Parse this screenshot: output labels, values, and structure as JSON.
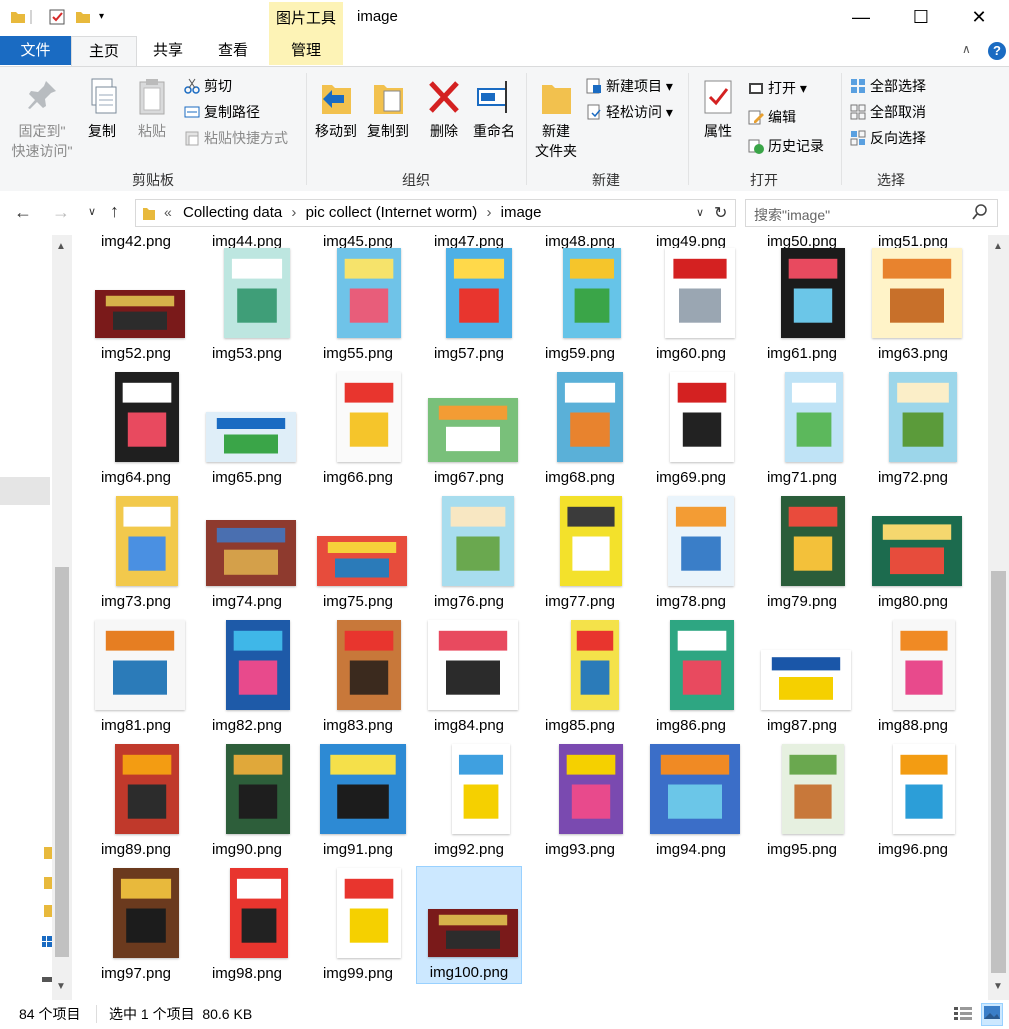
{
  "window": {
    "title": "image",
    "context_tab": "图片工具",
    "minimize_glyph": "—",
    "maximize_glyph": "☐",
    "close_glyph": "✕"
  },
  "ribbon_tabs": {
    "file": "文件",
    "home": "主页",
    "share": "共享",
    "view": "查看",
    "manage": "管理"
  },
  "clipboard": {
    "pin": "固定到\"",
    "pin2": "快速访问\"",
    "copy": "复制",
    "paste": "粘贴",
    "cut": "剪切",
    "copy_path": "复制路径",
    "paste_shortcut": "粘贴快捷方式",
    "label": "剪贴板"
  },
  "organize": {
    "move_to": "移动到",
    "copy_to": "复制到",
    "delete": "删除",
    "rename": "重命名",
    "label": "组织"
  },
  "new_group": {
    "new_folder": "新建",
    "new_folder2": "文件夹",
    "new_item": "新建项目",
    "easy_access": "轻松访问",
    "label": "新建"
  },
  "open_group": {
    "properties": "属性",
    "open": "打开",
    "edit": "编辑",
    "history": "历史记录",
    "label": "打开"
  },
  "select_group": {
    "select_all": "全部选择",
    "select_none": "全部取消",
    "invert": "反向选择",
    "label": "选择"
  },
  "address": {
    "crumbs": [
      "Collecting data",
      "pic collect (Internet worm)",
      "image"
    ],
    "search_placeholder": "搜索\"image\""
  },
  "partial_row": [
    "img42.png",
    "img44.png",
    "img45.png",
    "img47.png",
    "img48.png",
    "img49.png",
    "img50.png",
    "img51.png"
  ],
  "files": [
    "img52.png",
    "img53.png",
    "img55.png",
    "img57.png",
    "img59.png",
    "img60.png",
    "img61.png",
    "img63.png",
    "img64.png",
    "img65.png",
    "img66.png",
    "img67.png",
    "img68.png",
    "img69.png",
    "img71.png",
    "img72.png",
    "img73.png",
    "img74.png",
    "img75.png",
    "img76.png",
    "img77.png",
    "img78.png",
    "img79.png",
    "img80.png",
    "img81.png",
    "img82.png",
    "img83.png",
    "img84.png",
    "img85.png",
    "img86.png",
    "img87.png",
    "img88.png",
    "img89.png",
    "img90.png",
    "img91.png",
    "img92.png",
    "img93.png",
    "img94.png",
    "img95.png",
    "img96.png",
    "img97.png",
    "img98.png",
    "img99.png",
    "img100.png"
  ],
  "selected_file": "img100.png",
  "status": {
    "count": "84 个项目",
    "selection": "选中 1 个项目  80.6 KB"
  },
  "colors": {
    "accent": "#1a6bc2",
    "selection": "#cce8ff",
    "context_tab": "#fdf3b6"
  }
}
